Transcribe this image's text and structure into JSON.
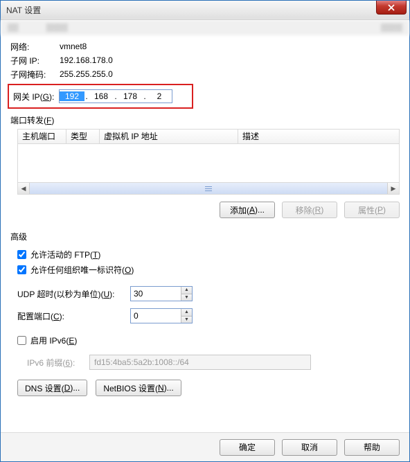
{
  "window": {
    "title": "NAT 设置"
  },
  "info": {
    "network_label": "网络:",
    "network_value": "vmnet8",
    "subnet_ip_label": "子网 IP:",
    "subnet_ip_value": "192.168.178.0",
    "subnet_mask_label": "子网掩码:",
    "subnet_mask_value": "255.255.255.0"
  },
  "gateway": {
    "label_prefix": "网关 IP(",
    "label_key": "G",
    "label_suffix": "):",
    "oct1": "192",
    "oct2": "168",
    "oct3": "178",
    "oct4": "2"
  },
  "port_forward": {
    "legend_prefix": "端口转发(",
    "legend_key": "F",
    "legend_suffix": ")",
    "columns": {
      "host_port": "主机端口",
      "type": "类型",
      "vm_ip": "虚拟机 IP 地址",
      "desc": "描述"
    },
    "buttons": {
      "add_prefix": "添加(",
      "add_key": "A",
      "add_suffix": ")...",
      "remove_prefix": "移除(",
      "remove_key": "R",
      "remove_suffix": ")",
      "props_prefix": "属性(",
      "props_key": "P",
      "props_suffix": ")"
    }
  },
  "advanced": {
    "legend": "高级",
    "ftp_checked": true,
    "ftp_prefix": "允许活动的 FTP(",
    "ftp_key": "T",
    "ftp_suffix": ")",
    "oui_checked": true,
    "oui_prefix": "允许任何组织唯一标识符(",
    "oui_key": "O",
    "oui_suffix": ")",
    "udp_label_prefix": "UDP 超时(以秒为单位)(",
    "udp_key": "U",
    "udp_suffix": "):",
    "udp_value": "30",
    "cfg_label_prefix": "配置端口(",
    "cfg_key": "C",
    "cfg_suffix": "):",
    "cfg_value": "0",
    "ipv6_checked": false,
    "ipv6_enable_prefix": "启用 IPv6(",
    "ipv6_enable_key": "E",
    "ipv6_enable_suffix": ")",
    "ipv6_prefix_label_prefix": "IPv6 前缀(",
    "ipv6_prefix_key": "6",
    "ipv6_prefix_label_suffix": "):",
    "ipv6_prefix_value": "fd15:4ba5:5a2b:1008::/64",
    "dns_btn_prefix": "DNS 设置(",
    "dns_btn_key": "D",
    "dns_btn_suffix": ")...",
    "netbios_btn_prefix": "NetBIOS 设置(",
    "netbios_btn_key": "N",
    "netbios_btn_suffix": ")..."
  },
  "footer": {
    "ok": "确定",
    "cancel": "取消",
    "help": "帮助"
  }
}
